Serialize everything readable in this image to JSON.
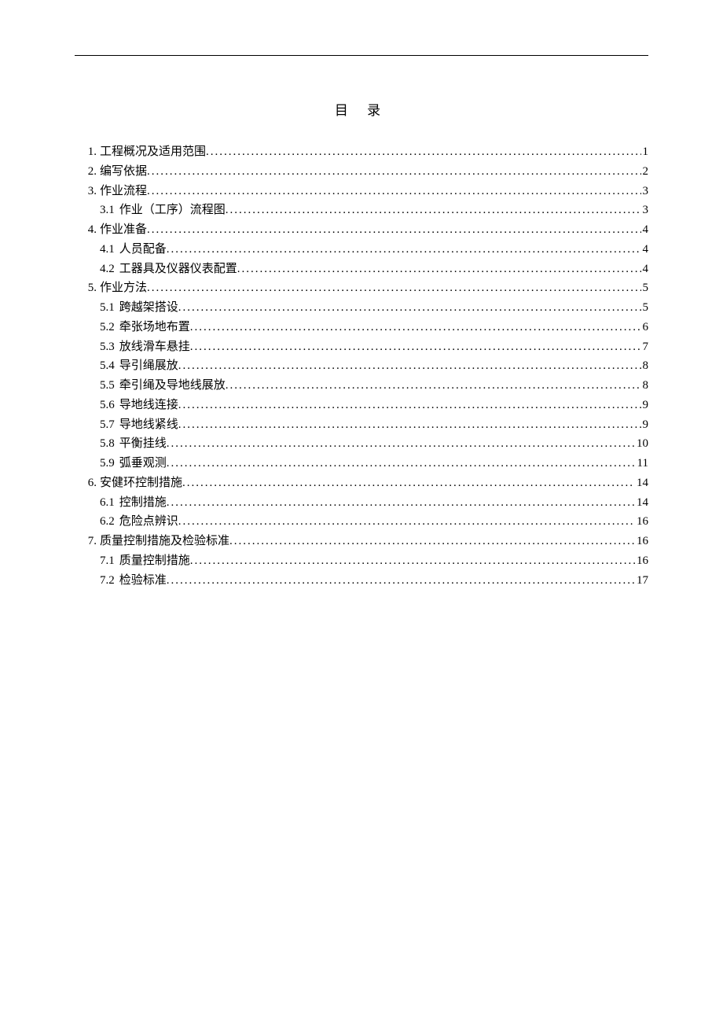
{
  "title": "目  录",
  "entries": [
    {
      "level": 1,
      "num": "1.",
      "label": "工程概况及适用范围",
      "page": "1"
    },
    {
      "level": 1,
      "num": "2.",
      "label": "编写依据",
      "page": "2"
    },
    {
      "level": 1,
      "num": "3.",
      "label": "作业流程",
      "page": "3"
    },
    {
      "level": 2,
      "num": "3.1",
      "label": "作业（工序）流程图",
      "page": "3"
    },
    {
      "level": 1,
      "num": "4.",
      "label": "作业准备",
      "page": "4"
    },
    {
      "level": 2,
      "num": "4.1",
      "label": "人员配备",
      "page": "4"
    },
    {
      "level": 2,
      "num": "4.2",
      "label": "工器具及仪器仪表配置",
      "page": "4"
    },
    {
      "level": 1,
      "num": "5.",
      "label": "作业方法",
      "page": "5"
    },
    {
      "level": 2,
      "num": "5.1",
      "label": "跨越架搭设",
      "page": "5"
    },
    {
      "level": 2,
      "num": "5.2",
      "label": "牵张场地布置",
      "page": "6"
    },
    {
      "level": 2,
      "num": "5.3",
      "label": "放线滑车悬挂",
      "page": "7"
    },
    {
      "level": 2,
      "num": "5.4",
      "label": "导引绳展放",
      "page": "8"
    },
    {
      "level": 2,
      "num": "5.5",
      "label": "牵引绳及导地线展放",
      "page": "8"
    },
    {
      "level": 2,
      "num": "5.6",
      "label": "导地线连接",
      "page": "9"
    },
    {
      "level": 2,
      "num": "5.7",
      "label": "导地线紧线",
      "page": "9"
    },
    {
      "level": 2,
      "num": "5.8",
      "label": "平衡挂线",
      "page": "10"
    },
    {
      "level": 2,
      "num": "5.9",
      "label": "弧垂观测",
      "page": "11"
    },
    {
      "level": 1,
      "num": "6.",
      "label": "安健环控制措施",
      "page": "14"
    },
    {
      "level": 2,
      "num": "6.1",
      "label": "控制措施",
      "page": "14"
    },
    {
      "level": 2,
      "num": "6.2",
      "label": "危险点辨识",
      "page": "16"
    },
    {
      "level": 1,
      "num": "7.",
      "label": "质量控制措施及检验标准",
      "page": "16"
    },
    {
      "level": 2,
      "num": "7.1",
      "label": "质量控制措施",
      "page": "16"
    },
    {
      "level": 2,
      "num": "7.2",
      "label": "检验标准",
      "page": "17"
    }
  ]
}
